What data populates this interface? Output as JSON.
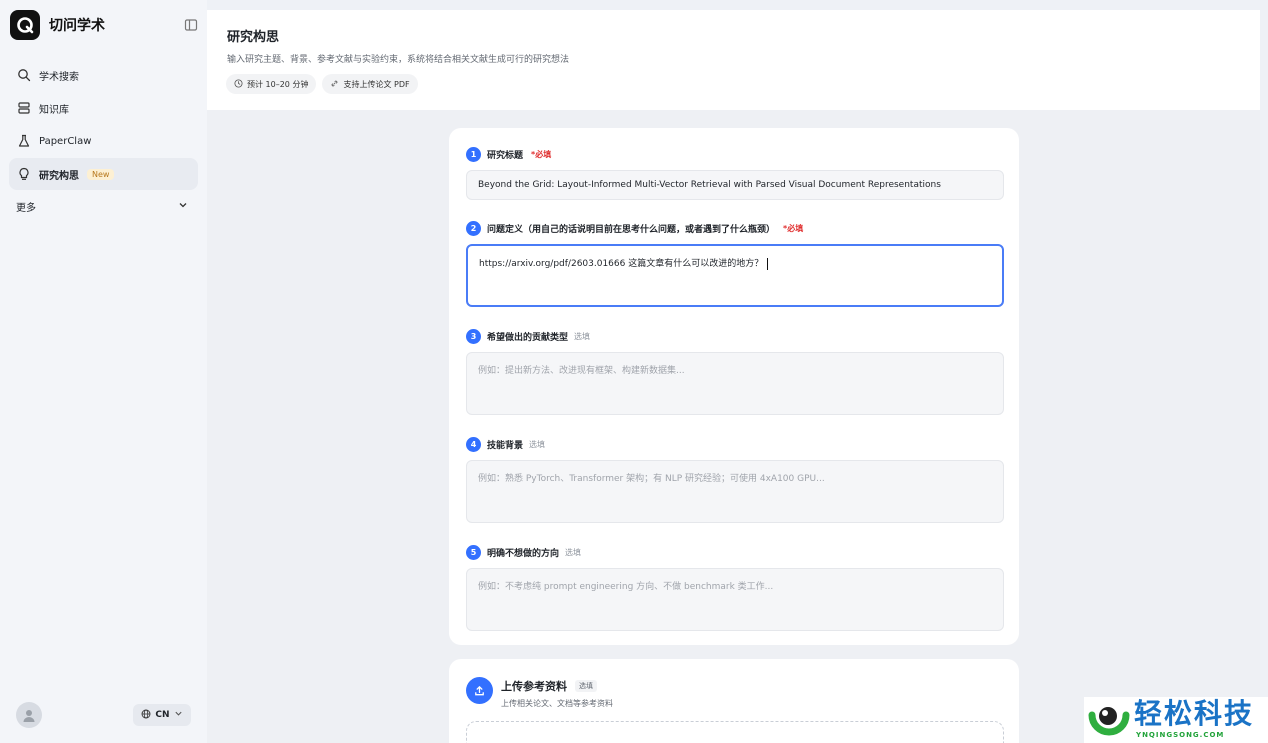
{
  "sidebar": {
    "brand": "切问学术",
    "items": [
      {
        "label": "学术搜索",
        "icon": "search-icon"
      },
      {
        "label": "知识库",
        "icon": "database-icon"
      },
      {
        "label": "PaperClaw",
        "icon": "flask-icon"
      },
      {
        "label": "研究构思",
        "icon": "lightbulb-icon",
        "badge": "New"
      }
    ],
    "more_label": "更多",
    "lang_label": "CN"
  },
  "header": {
    "title": "研究构思",
    "subtitle": "输入研究主题、背景、参考文献与实验约束，系统将结合相关文献生成可行的研究想法",
    "chips": [
      "预计 10–20 分钟",
      "支持上传论文 PDF"
    ]
  },
  "form": {
    "fields": [
      {
        "num": "1",
        "label": "研究标题",
        "required": "*必填",
        "value": "Beyond the Grid: Layout-Informed Multi-Vector Retrieval with Parsed Visual Document Representations"
      },
      {
        "num": "2",
        "label": "问题定义（用自己的话说明目前在思考什么问题，或者遇到了什么瓶颈）",
        "required": "*必填",
        "value": "https://arxiv.org/pdf/2603.01666  这篇文章有什么可以改进的地方？"
      },
      {
        "num": "3",
        "label": "希望做出的贡献类型",
        "optional": "选填",
        "placeholder": "例如：提出新方法、改进现有框架、构建新数据集..."
      },
      {
        "num": "4",
        "label": "技能背景",
        "optional": "选填",
        "placeholder": "例如：熟悉 PyTorch、Transformer 架构；有 NLP 研究经验；可使用 4xA100 GPU..."
      },
      {
        "num": "5",
        "label": "明确不想做的方向",
        "optional": "选填",
        "placeholder": "例如：不考虑纯 prompt engineering 方向、不做 benchmark 类工作..."
      }
    ]
  },
  "upload": {
    "title": "上传参考资料",
    "tag": "选填",
    "subtitle": "上传相关论文、文档等参考资料"
  },
  "watermark": {
    "text": "轻松科技",
    "sub": "YNQINGSONG.COM"
  },
  "colors": {
    "accent": "#3370ff",
    "required": "#e03131"
  }
}
